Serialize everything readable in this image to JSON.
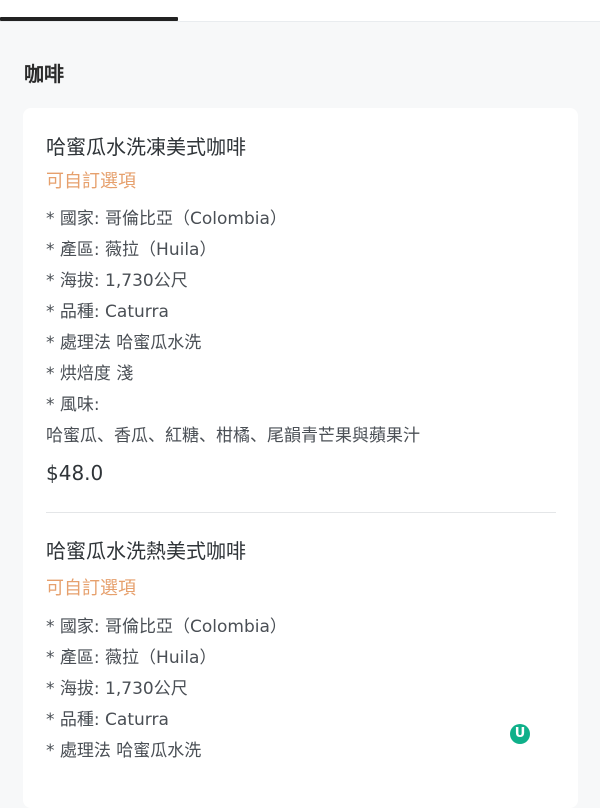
{
  "tabs": {
    "active_index": 0
  },
  "section": {
    "title": "咖啡"
  },
  "items": [
    {
      "name": "哈蜜瓜水洗凍美式咖啡",
      "option": "可自訂選項",
      "description": [
        "* 國家: 哥倫比亞（Colombia）",
        "* 產區: 薇拉（Huila）",
        "* 海拔: 1,730公尺",
        "* 品種: Caturra",
        "* 處理法 哈蜜瓜水洗",
        "* 烘焙度 淺",
        "* 風味:",
        "哈蜜瓜、香瓜、紅糖、柑橘、尾韻青芒果與蘋果汁"
      ],
      "price": "$48.0"
    },
    {
      "name": "哈蜜瓜水洗熱美式咖啡",
      "option": "可自訂選項",
      "description": [
        "* 國家: 哥倫比亞（Colombia）",
        "* 產區: 薇拉（Huila）",
        "* 海拔: 1,730公尺",
        "* 品種: Caturra",
        "* 處理法 哈蜜瓜水洗"
      ],
      "price": ""
    }
  ],
  "watermark": {
    "icon": "brand-logo-icon",
    "color": "#0fb08a",
    "glyph": "U"
  },
  "colors": {
    "option_accent": "#e6a06d",
    "tab_indicator": "#222222"
  }
}
